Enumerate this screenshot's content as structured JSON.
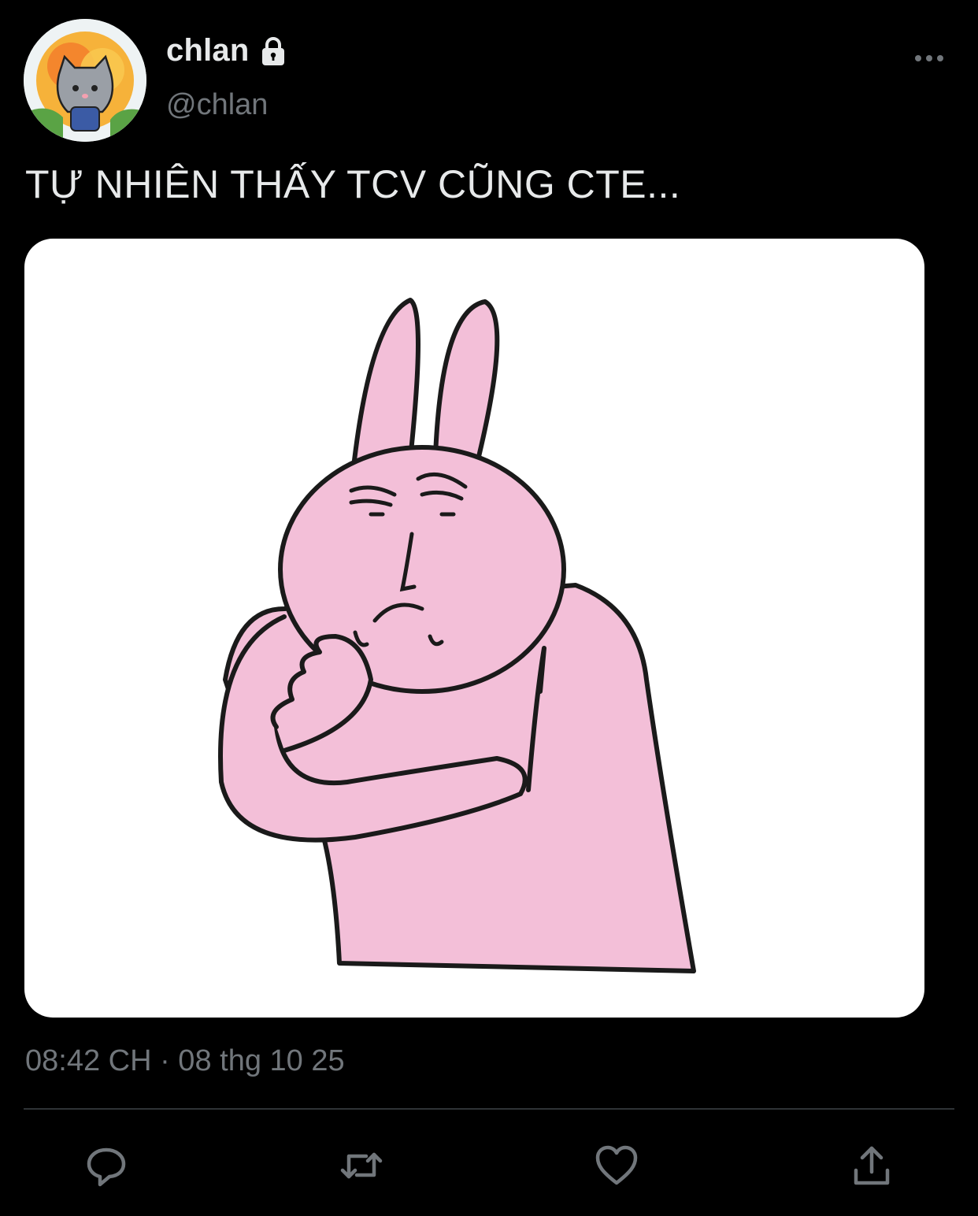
{
  "tweet": {
    "display_name": "chlan",
    "handle": "@chlan",
    "text": "TỰ NHIÊN THẤY TCV CŨNG CTE...",
    "timestamp": "08:42 CH · 08 thg 10 25",
    "protected_icon": "lock-icon",
    "more_icon": "more-horizontal-icon"
  },
  "actions": {
    "reply_icon": "reply-icon",
    "retweet_icon": "retweet-icon",
    "like_icon": "heart-icon",
    "share_icon": "share-icon"
  },
  "colors": {
    "background": "#000000",
    "primary_text": "#e7e9ea",
    "secondary_text": "#71767b",
    "divider": "#2f3336",
    "bunny_pink": "#f3bfd8"
  }
}
